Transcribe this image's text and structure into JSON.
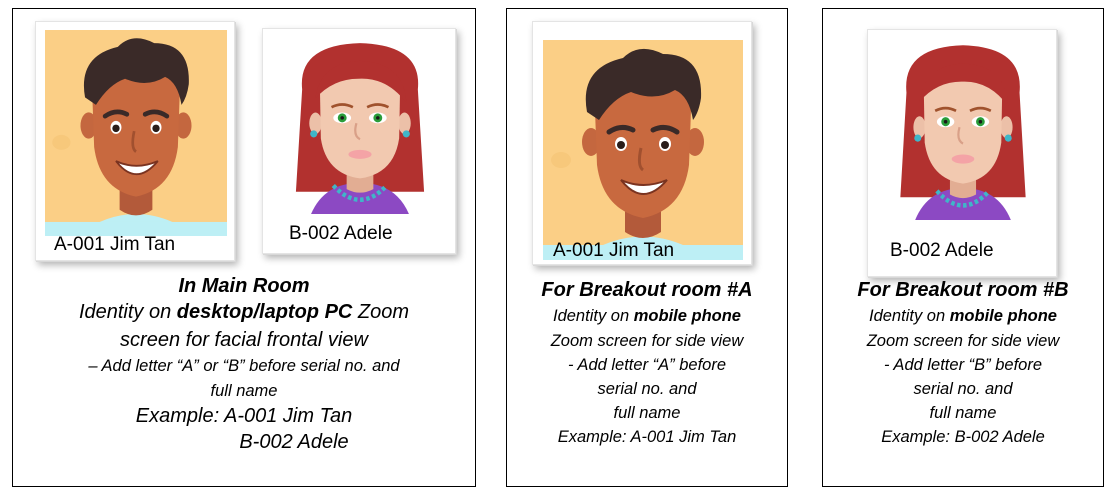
{
  "panels": {
    "main": {
      "card1_name": "A-001 Jim Tan",
      "card2_name": "B-002 Adele",
      "title": "In Main Room",
      "line1_pre": "Identity on ",
      "line1_bold": "desktop/laptop PC",
      "line1_post": " Zoom",
      "line2": "screen for facial frontal view",
      "line3": "– Add letter “A” or “B” before serial no. and",
      "line4": "full name",
      "line5": "Example: A-001 Jim Tan",
      "line6": "B-002 Adele"
    },
    "a": {
      "card_name": "A-001 Jim Tan",
      "title": "For Breakout room #A",
      "line1_pre": "Identity on ",
      "line1_bold": "mobile phone",
      "line2": "Zoom screen for side view",
      "line3": "- Add letter “A” before",
      "line4": "serial no. and",
      "line5": "full name",
      "line6": "Example: A-001 Jim Tan"
    },
    "b": {
      "card_name": "B-002 Adele",
      "title": "For Breakout room #B",
      "line1_pre": "Identity on ",
      "line1_bold": "mobile phone",
      "line2": "Zoom screen for side view",
      "line3": "- Add letter “B” before",
      "line4": "serial no. and",
      "line5": "full name",
      "line6": "Example: B-002 Adele"
    }
  }
}
